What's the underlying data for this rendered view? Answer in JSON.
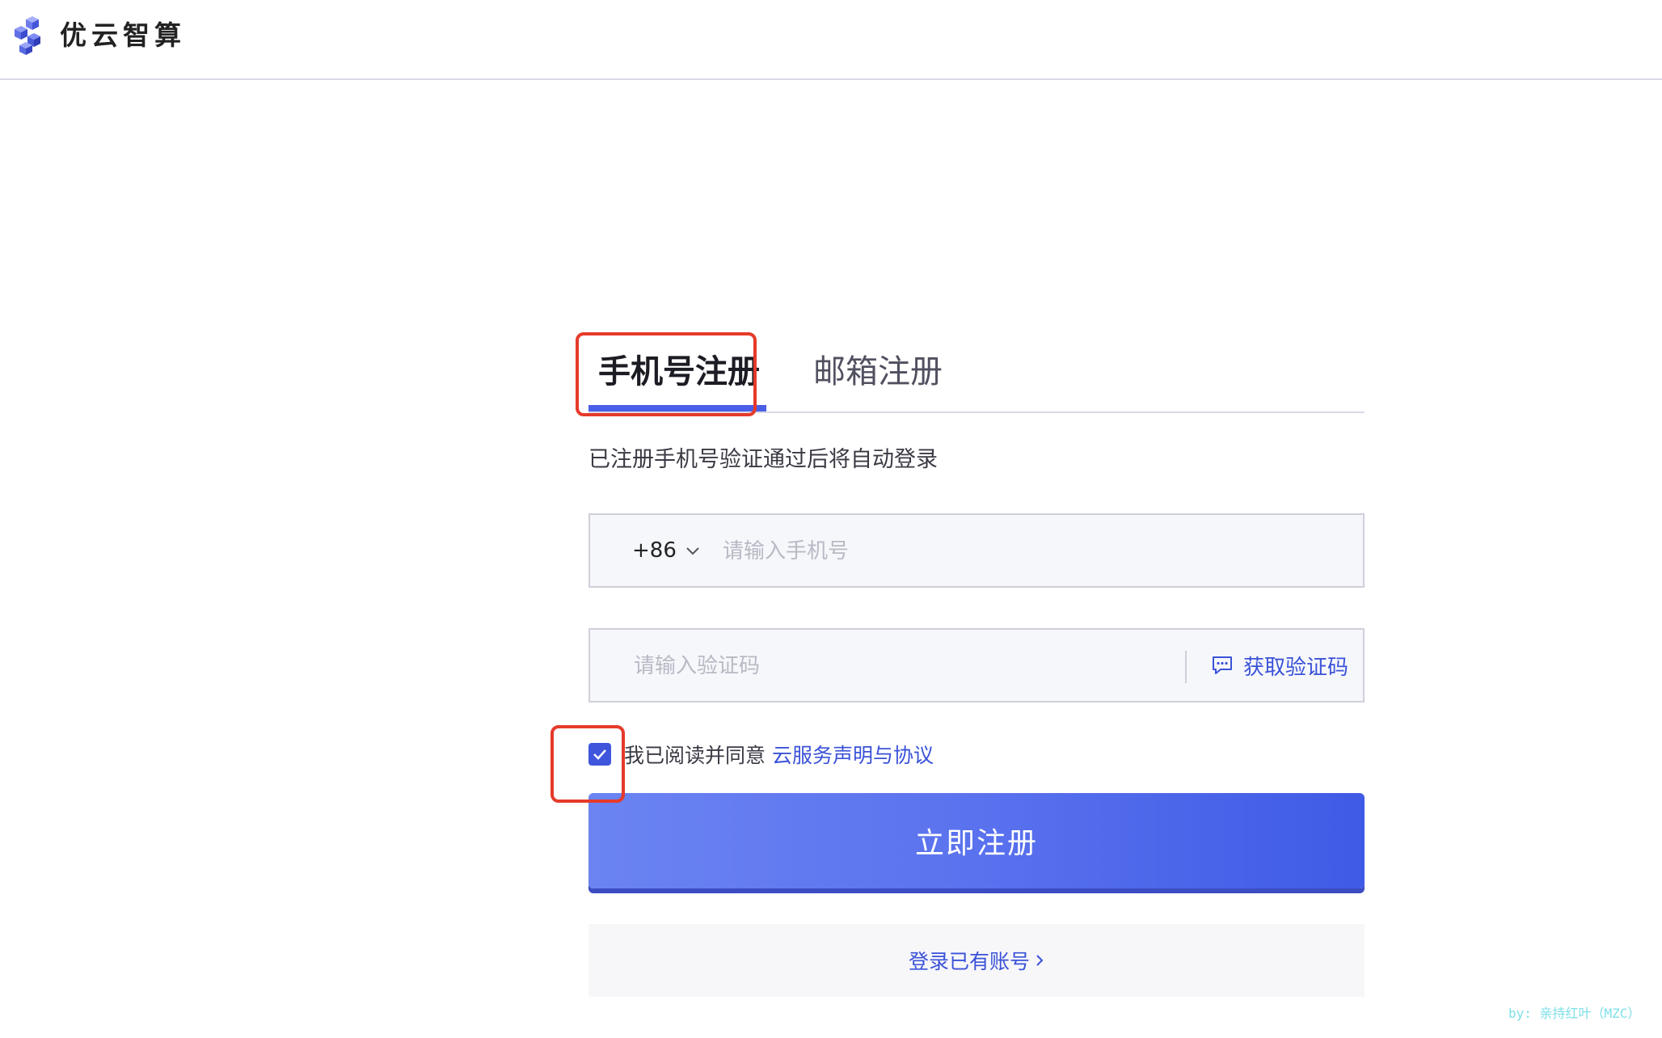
{
  "header": {
    "brand_name": "优云智算"
  },
  "tabs": [
    {
      "label": "手机号注册",
      "active": true
    },
    {
      "label": "邮箱注册",
      "active": false
    }
  ],
  "form": {
    "subtitle": "已注册手机号验证通过后将自动登录",
    "country_code": "+86",
    "phone_placeholder": "请输入手机号",
    "code_placeholder": "请输入验证码",
    "get_code_label": "获取验证码",
    "agree_checked": true,
    "agree_text": "我已阅读并同意",
    "agree_link": "云服务声明与协议",
    "submit_label": "立即注册",
    "login_link": "登录已有账号"
  },
  "watermark": "by: 亲持红叶（MZC）",
  "colors": {
    "accent": "#3f55dc",
    "link": "#3a52d8",
    "annotation": "#e63a2a"
  },
  "icons": [
    "logo-cubes-icon",
    "chevron-down-icon",
    "message-icon",
    "checkmark-icon",
    "chevron-right-icon"
  ]
}
